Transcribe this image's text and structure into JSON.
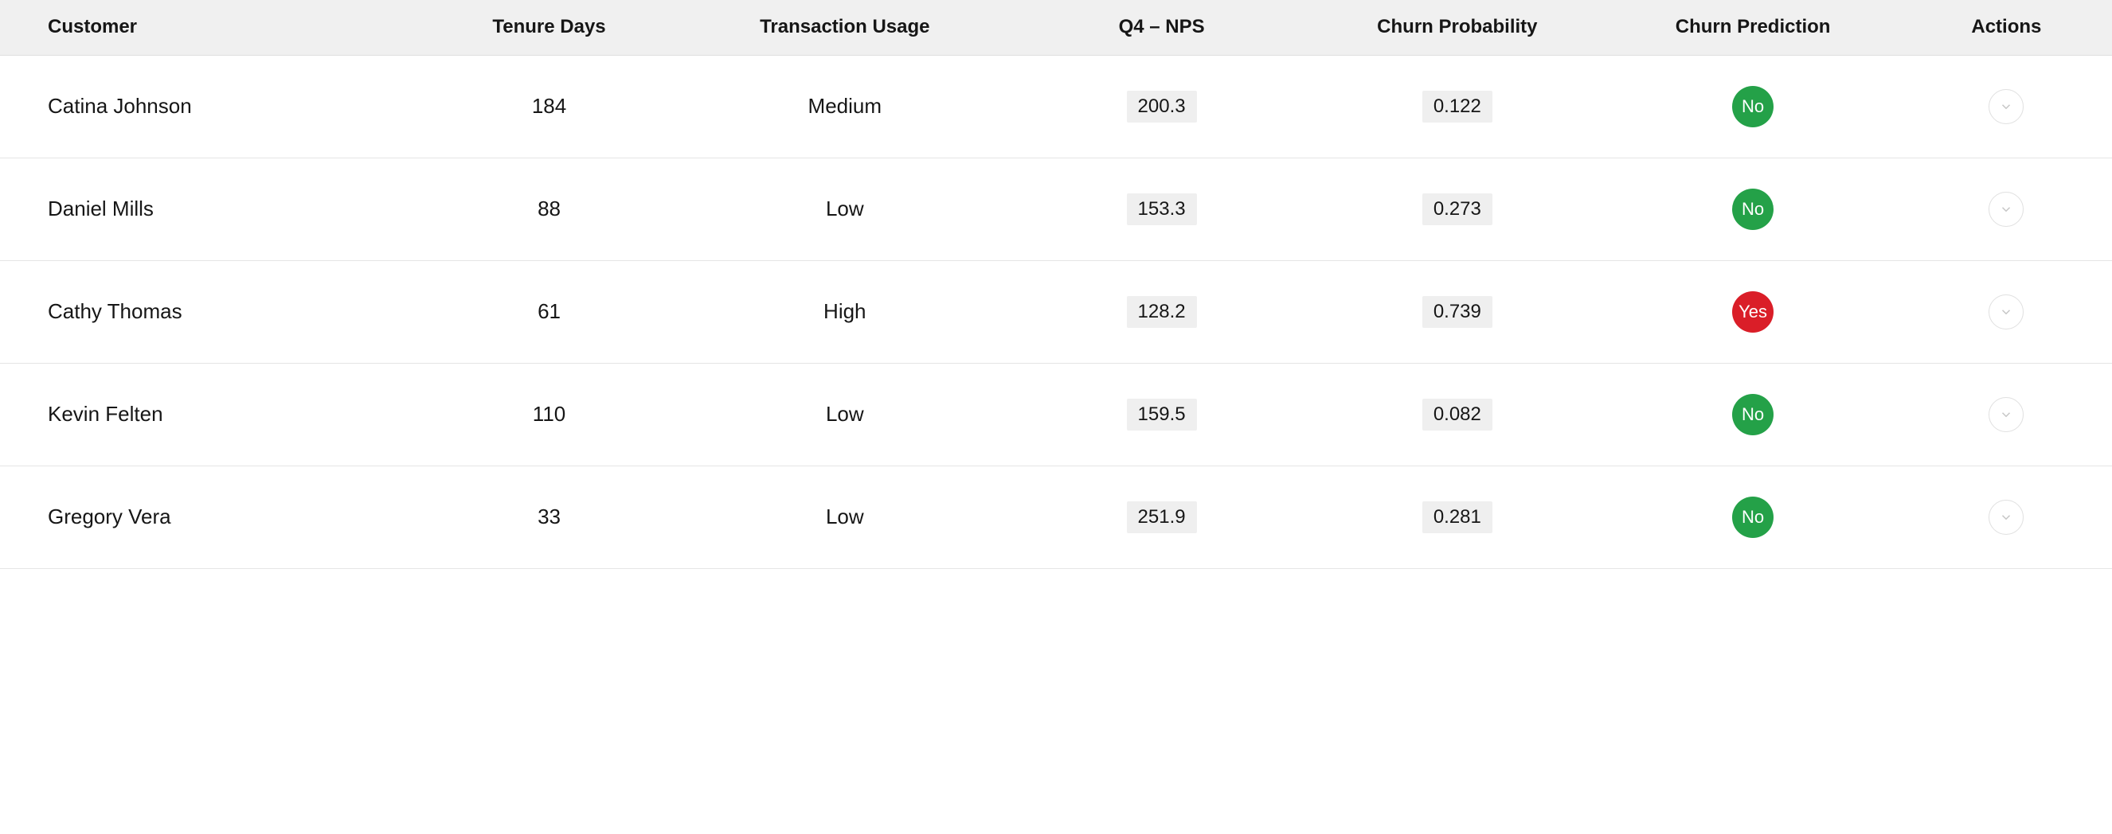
{
  "columns": {
    "customer": "Customer",
    "tenure": "Tenure Days",
    "usage": "Transaction Usage",
    "nps": "Q4 – NPS",
    "prob": "Churn Probability",
    "pred": "Churn Prediction",
    "actions": "Actions"
  },
  "badge_labels": {
    "no": "No",
    "yes": "Yes"
  },
  "colors": {
    "badge_no": "#24a148",
    "badge_yes": "#da1e28"
  },
  "rows": [
    {
      "customer": "Catina Johnson",
      "tenure": "184",
      "usage": "Medium",
      "nps": "200.3",
      "prob": "0.122",
      "pred": "no"
    },
    {
      "customer": "Daniel Mills",
      "tenure": "88",
      "usage": "Low",
      "nps": "153.3",
      "prob": "0.273",
      "pred": "no"
    },
    {
      "customer": "Cathy Thomas",
      "tenure": "61",
      "usage": "High",
      "nps": "128.2",
      "prob": "0.739",
      "pred": "yes"
    },
    {
      "customer": "Kevin Felten",
      "tenure": "110",
      "usage": "Low",
      "nps": "159.5",
      "prob": "0.082",
      "pred": "no"
    },
    {
      "customer": "Gregory Vera",
      "tenure": "33",
      "usage": "Low",
      "nps": "251.9",
      "prob": "0.281",
      "pred": "no"
    }
  ]
}
